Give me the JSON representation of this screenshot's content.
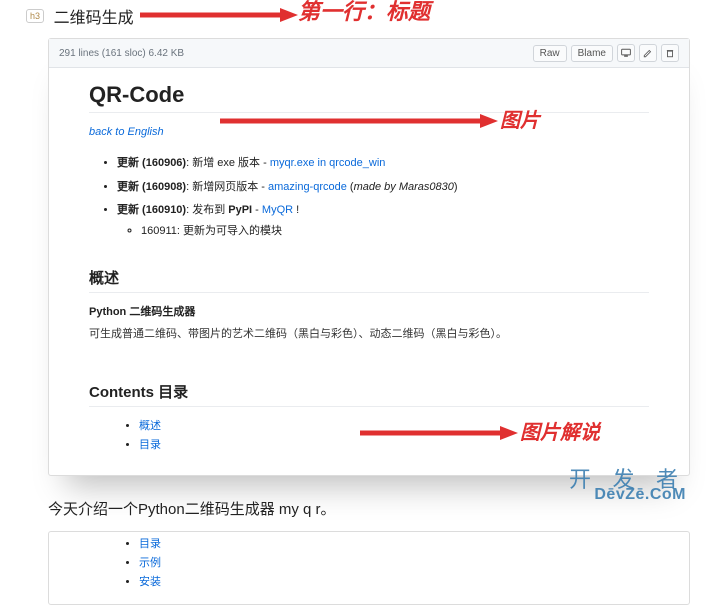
{
  "top": {
    "badge": "h3",
    "heading": "二维码生成"
  },
  "annotations": {
    "row1": "第一行：标题",
    "img": "图片",
    "caption": "图片解说"
  },
  "card": {
    "meta": "291 lines (161 sloc)    6.42 KB",
    "buttons": {
      "raw": "Raw",
      "blame": "Blame"
    },
    "h1": "QR-Code",
    "back": "back to English",
    "updates": [
      {
        "prefix": "更新 (160906)",
        "text": ": 新增 exe 版本 - ",
        "link": "myqr.exe in qrcode_win",
        "tail": ""
      },
      {
        "prefix": "更新 (160908)",
        "text": ": 新增网页版本 - ",
        "link": "amazing-qrcode",
        "tail_before_italic": " (",
        "italic": "made by Maras0830",
        "tail": ")"
      },
      {
        "prefix": "更新 (160910)",
        "text": ": 发布到 ",
        "bold2": "PyPI",
        "text2": " - ",
        "link": "MyQR",
        "tail": " !"
      }
    ],
    "subitem": "160911: 更新为可导入的模块",
    "overview_h": "概述",
    "overview_bold": "Python 二维码生成器",
    "overview_desc": "可生成普通二维码、带图片的艺术二维码（黑白与彩色）、动态二维码（黑白与彩色）。",
    "contents_h": "Contents 目录",
    "toc1": [
      "概述",
      "目录"
    ]
  },
  "caption": "今天介绍一个Python二维码生成器 my q r。",
  "card2": {
    "toc": [
      "目录",
      "示例",
      "安装"
    ]
  },
  "watermark": {
    "cn": "开 发 者",
    "en": "DēvZē.CoM"
  }
}
